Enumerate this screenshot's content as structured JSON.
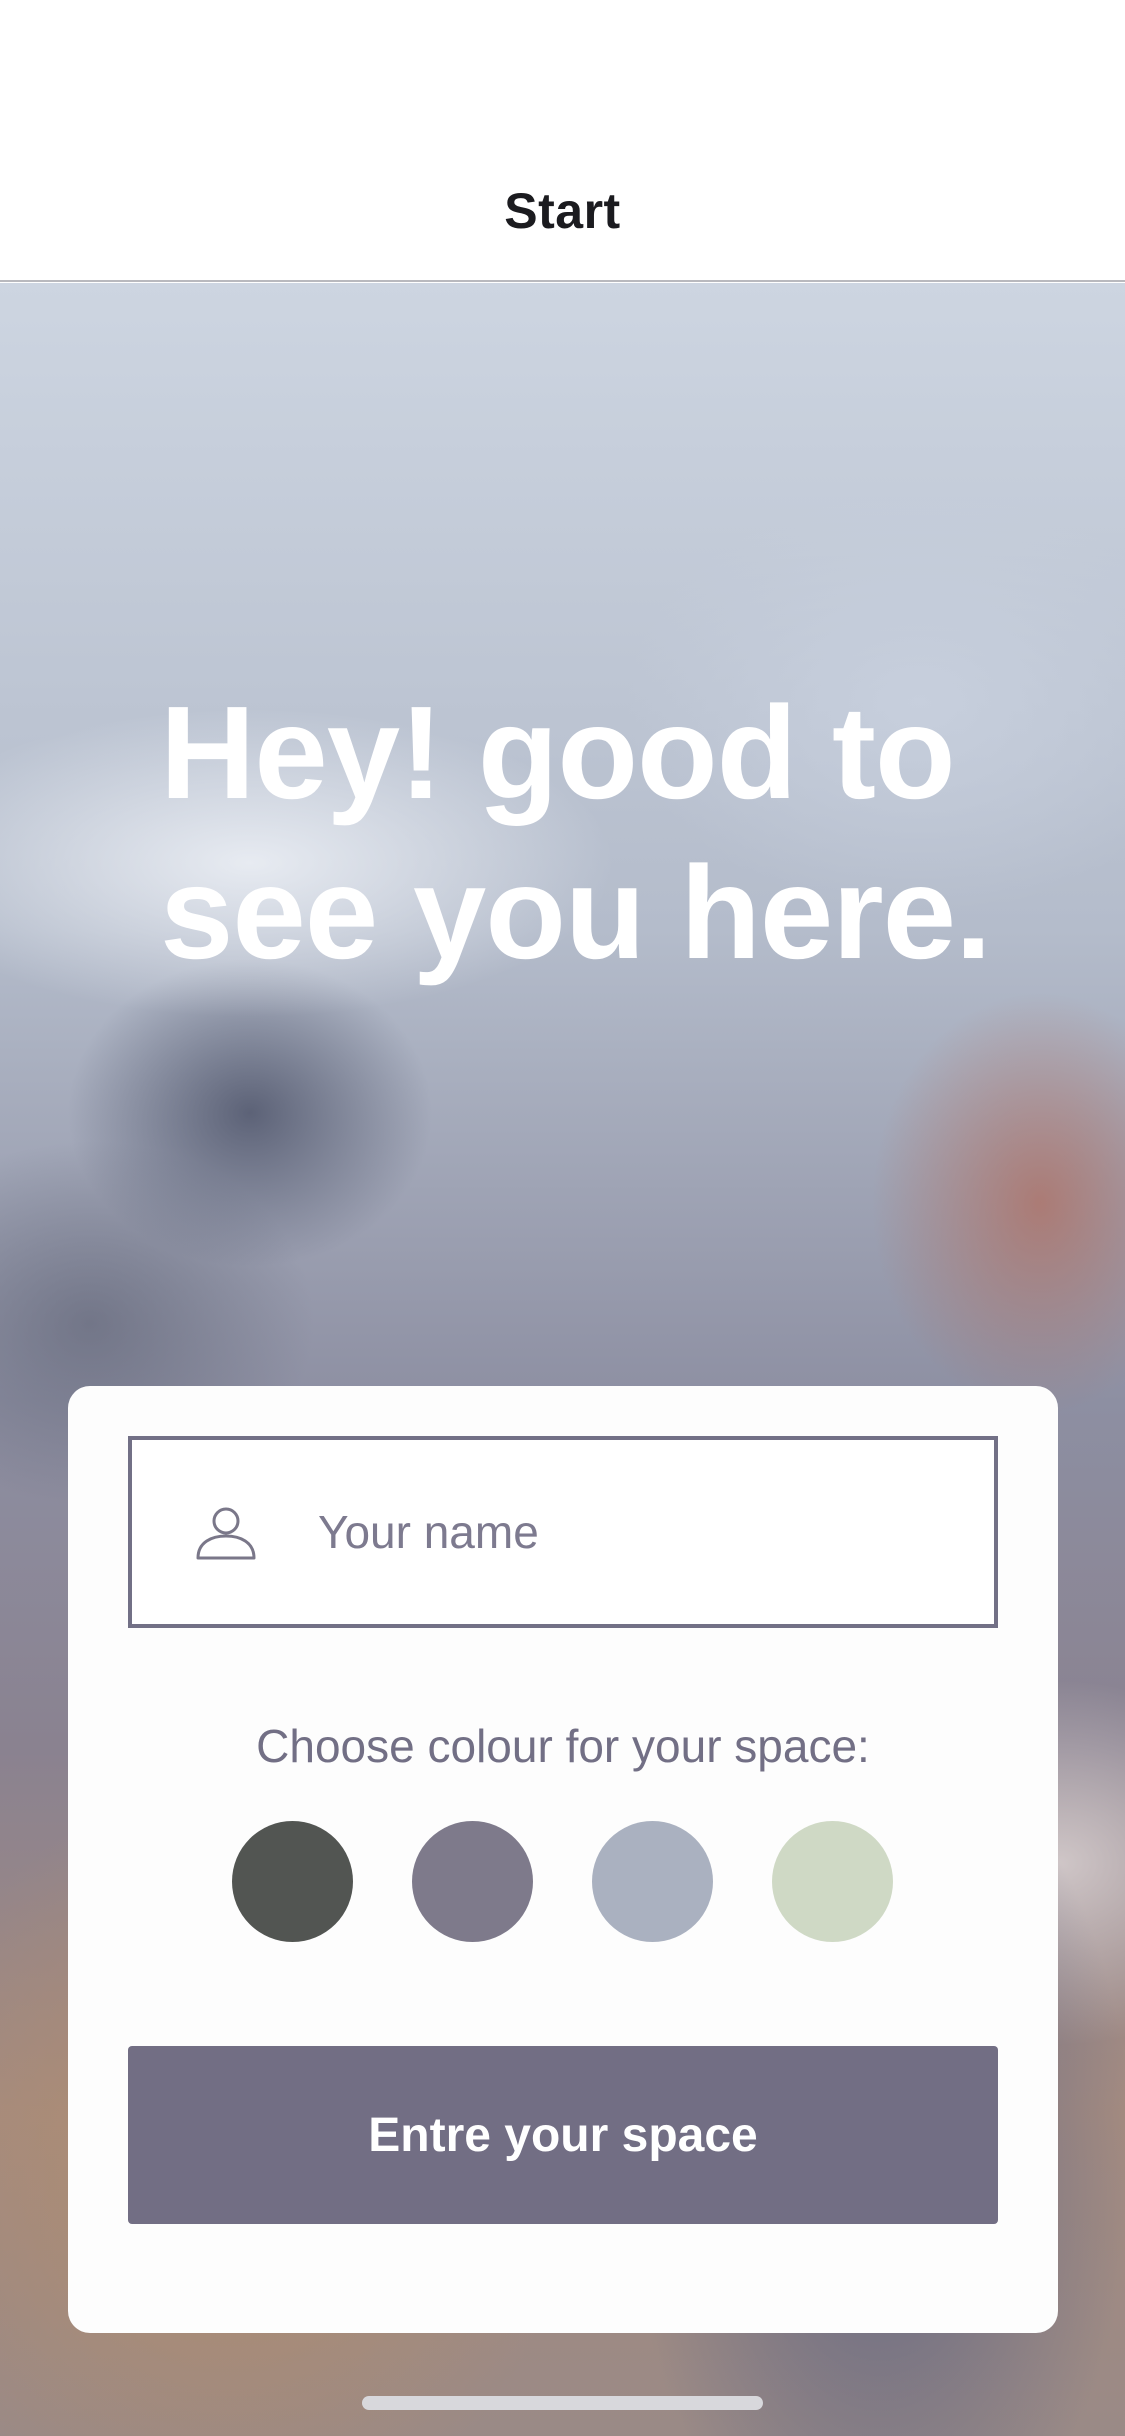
{
  "nav": {
    "title": "Start"
  },
  "hero": {
    "headline": "Hey! good to see you here."
  },
  "form": {
    "name_field": {
      "placeholder": "Your name",
      "value": ""
    },
    "colour_prompt": "Choose colour for your space:",
    "colour_options": [
      {
        "name": "dark-grey",
        "color": "#525552"
      },
      {
        "name": "muted-purple",
        "color": "#7e7a8b"
      },
      {
        "name": "light-blue-grey",
        "color": "#aab1c0"
      },
      {
        "name": "sage-green",
        "color": "#cfd9c5"
      }
    ],
    "submit_label": "Entre your space"
  },
  "colors": {
    "accent": "#726e84",
    "field_border": "#727086",
    "text_muted": "#726f85"
  }
}
